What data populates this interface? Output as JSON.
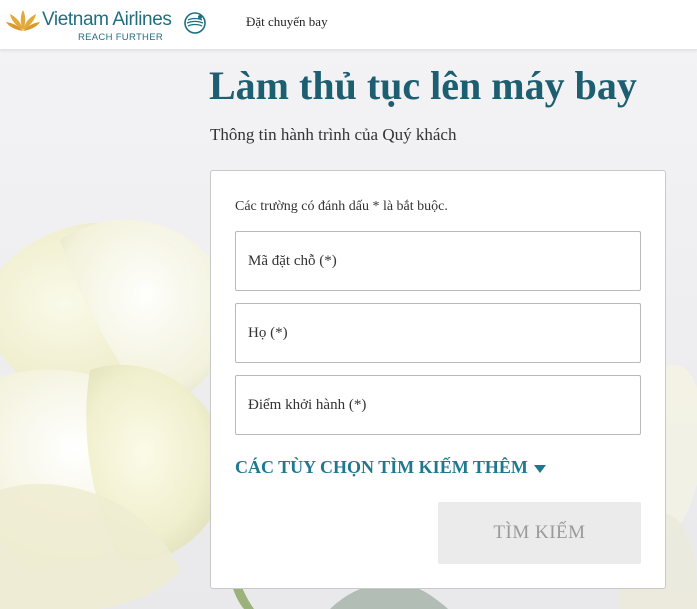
{
  "brand": {
    "name": "Vietnam Airlines",
    "tagline": "REACH FURTHER",
    "colors": {
      "primary": "#1d5e70",
      "link": "#1e7890",
      "lotus": "#e3a93a"
    }
  },
  "header": {
    "nav_book": "Đặt chuyến bay",
    "icons": [
      "lotus-logo-icon",
      "skyteam-icon"
    ]
  },
  "page": {
    "title": "Làm thủ tục lên máy bay",
    "subtitle": "Thông tin hành trình của Quý khách"
  },
  "form": {
    "required_note": "Các trường có đánh dấu * là bắt buộc.",
    "fields": [
      {
        "placeholder": "Mã đặt chỗ (*)",
        "value": ""
      },
      {
        "placeholder": "Họ (*)",
        "value": ""
      },
      {
        "placeholder": "Điểm khởi hành (*)",
        "value": ""
      }
    ],
    "more_options": "CÁC TÙY CHỌN TÌM KIẾM THÊM",
    "more_options_icon": "caret-down-icon",
    "search_button": "TÌM KIẾM"
  }
}
